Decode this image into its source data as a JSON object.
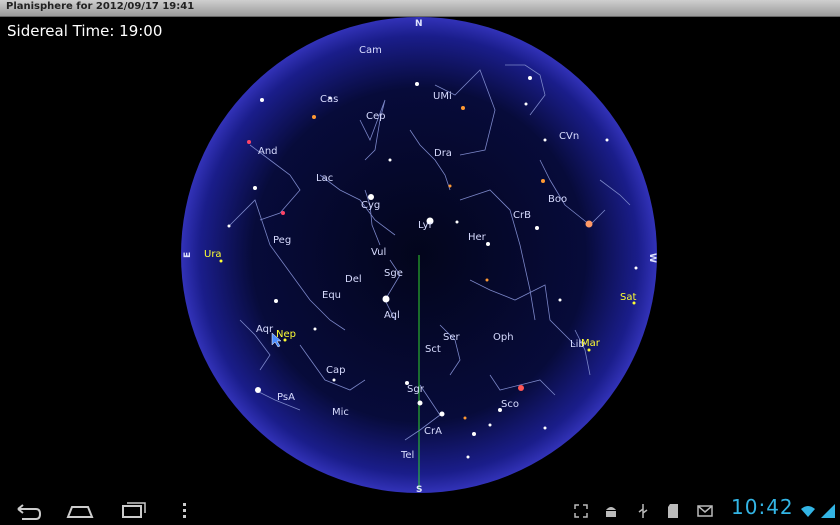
{
  "window": {
    "title": "Planisphere for 2012/09/17 19:41"
  },
  "sidereal_time": "Sidereal Time: 19:00",
  "compass": {
    "north": "N",
    "south": "S",
    "east": "E",
    "west": "W"
  },
  "constellations": [
    "Cam",
    "Cas",
    "UMi",
    "Cep",
    "CVn",
    "And",
    "Dra",
    "Lac",
    "Cyg",
    "Boo",
    "CrB",
    "Lyr",
    "Peg",
    "Her",
    "Vul",
    "Sge",
    "Del",
    "Equ",
    "Aql",
    "Ser",
    "Sct",
    "Oph",
    "Aqr",
    "Cap",
    "Lib",
    "PsA",
    "Mic",
    "Sco",
    "Sgr",
    "CrA",
    "Tel"
  ],
  "planets": [
    "Ura",
    "Nep",
    "Sat",
    "Mar"
  ],
  "colors": {
    "sky_edge": "#2a2aa8",
    "sky_center": "#05082a",
    "planet_label": "#ffff33",
    "clock": "#33b5e5"
  },
  "status": {
    "time": "10:42"
  },
  "icons": [
    "back-icon",
    "home-icon",
    "recent-apps-icon",
    "menu-icon",
    "fullscreen-icon",
    "android-icon",
    "usb-icon",
    "sd-card-icon",
    "email-icon",
    "wifi-icon",
    "signal-icon"
  ]
}
